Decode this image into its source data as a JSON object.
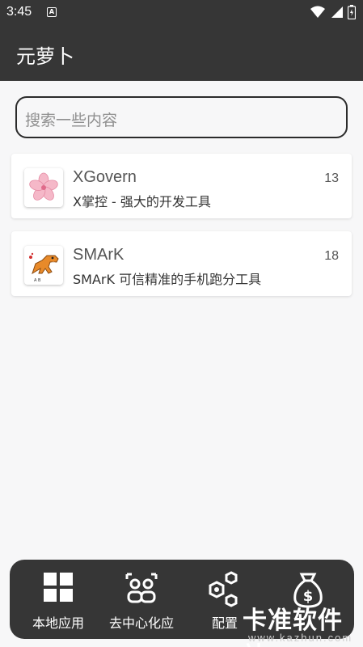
{
  "status": {
    "time": "3:45",
    "notif_badge": "A"
  },
  "app": {
    "title": "元萝卜"
  },
  "search": {
    "placeholder": "搜索一些内容"
  },
  "apps": [
    {
      "name": "XGovern",
      "desc": "X掌控 - 强大的开发工具",
      "count": "13",
      "icon": "sakura-icon"
    },
    {
      "name": "SMArK",
      "desc": "SMArK 可信精准的手机跑分工具",
      "count": "18",
      "icon": "dinosaur-icon"
    }
  ],
  "nav": [
    {
      "label": "本地应用",
      "icon": "grid-icon"
    },
    {
      "label": "去中心化应",
      "icon": "people-icon"
    },
    {
      "label": "配置",
      "icon": "hexagon-icon"
    },
    {
      "label": "",
      "icon": "money-bag-icon"
    }
  ],
  "watermark": {
    "main": "卡准软件站",
    "sub": "www.kazhun.com"
  },
  "colors": {
    "bar": "#363636",
    "background": "#f7f7f8"
  }
}
